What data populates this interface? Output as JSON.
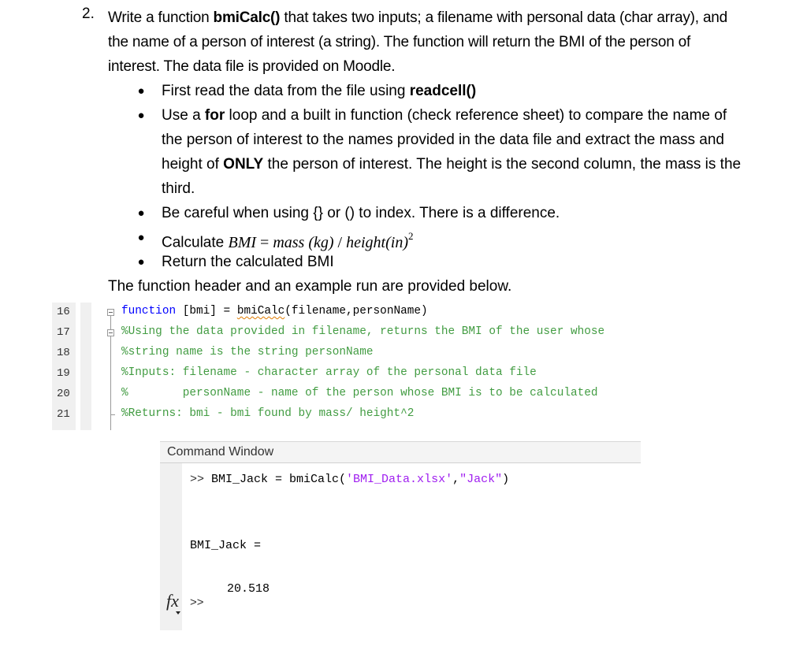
{
  "question": {
    "number": "2.",
    "intro_pre": "Write a function ",
    "intro_func": "bmiCalc()",
    "intro_post": " that takes two inputs; a filename with personal data (char array), and the name of a person of interest (a string).  The function will return the BMI of the person of interest.  The data file is provided on Moodle.",
    "bullets": {
      "b1_pre": "First read the data from the file using ",
      "b1_bold": "readcell()",
      "b2_pre": "Use a ",
      "b2_bold1": "for",
      "b2_mid": " loop and a built in function (check reference sheet) to compare the name of the person of interest to the names provided in the data file and extract the mass and height of ",
      "b2_bold2": "ONLY",
      "b2_post": " the person of interest.  The height is the second column, the mass is the third.",
      "b3": "Be careful when using {} or () to index.  There is a difference.",
      "b4_pre": "Calculate ",
      "b4_formula_lhs": "BMI",
      "b4_formula_eq": " = ",
      "b4_formula_mass": "mass ",
      "b4_formula_kg": "(kg)",
      "b4_formula_div": " / ",
      "b4_formula_height": "height",
      "b4_formula_in": "(in)",
      "b4_formula_exp": "2",
      "b5": "Return the calculated BMI"
    },
    "closing": "The function header and an example run are provided below."
  },
  "editor": {
    "line_numbers": [
      "16",
      "17",
      "18",
      "19",
      "20",
      "21"
    ],
    "line16": {
      "kw": "function",
      "pre": " [bmi] = ",
      "fname": "bmiCalc",
      "post": "(filename,personName)"
    },
    "line17": "%Using the data provided in filename, returns the BMI of the user whose",
    "line18": "%string name is the string personName",
    "line19": "%Inputs: filename - character array of the personal data file",
    "line20": "%        personName - name of the person whose BMI is to be calculated",
    "line21": "%Returns: bmi - bmi found by mass/ height^2"
  },
  "command_window": {
    "title": "Command Window",
    "cmd_prompt": ">> ",
    "cmd_pre": "BMI_Jack = bmiCalc(",
    "cmd_arg1": "'BMI_Data.xlsx'",
    "cmd_comma": ",",
    "cmd_arg2": "\"Jack\"",
    "cmd_close": ")",
    "output_var": "BMI_Jack =",
    "output_value": "20.518",
    "fx_label": "fx",
    "idle_prompt": ">>"
  }
}
